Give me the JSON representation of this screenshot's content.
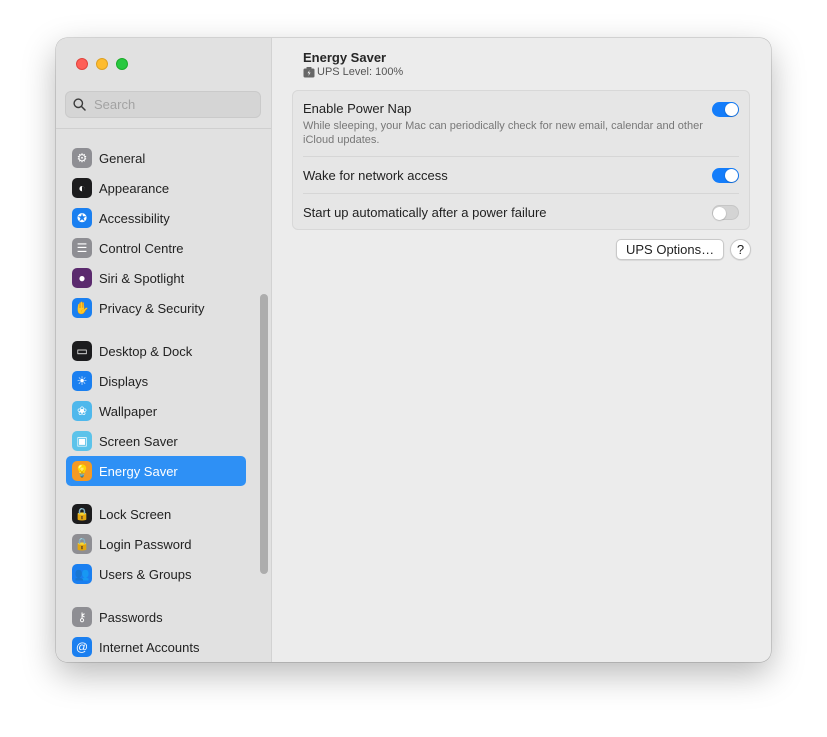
{
  "window": {
    "traffic_lights": [
      "close",
      "minimize",
      "maximize"
    ]
  },
  "sidebar": {
    "search_placeholder": "Search",
    "search_value": "",
    "groups": [
      [
        {
          "label": "General",
          "icon": "gear-icon",
          "color": "#8e8e93"
        },
        {
          "label": "Appearance",
          "icon": "appearance-icon",
          "color": "#1c1c1e"
        },
        {
          "label": "Accessibility",
          "icon": "accessibility-icon",
          "color": "#1a7ff0"
        },
        {
          "label": "Control Centre",
          "icon": "control-centre-icon",
          "color": "#8e8e93"
        },
        {
          "label": "Siri & Spotlight",
          "icon": "siri-icon",
          "color": "#5b2a6e"
        },
        {
          "label": "Privacy & Security",
          "icon": "hand-icon",
          "color": "#1a7ff0"
        }
      ],
      [
        {
          "label": "Desktop & Dock",
          "icon": "dock-icon",
          "color": "#1c1c1e"
        },
        {
          "label": "Displays",
          "icon": "sun-icon",
          "color": "#1a7ff0"
        },
        {
          "label": "Wallpaper",
          "icon": "flower-icon",
          "color": "#4fb8ec"
        },
        {
          "label": "Screen Saver",
          "icon": "screen-saver-icon",
          "color": "#5cc3ea"
        },
        {
          "label": "Energy Saver",
          "icon": "lightbulb-icon",
          "color": "#f59a23",
          "active": true
        }
      ],
      [
        {
          "label": "Lock Screen",
          "icon": "lock-screen-icon",
          "color": "#1c1c1e"
        },
        {
          "label": "Login Password",
          "icon": "lock-icon",
          "color": "#8e8e93"
        },
        {
          "label": "Users & Groups",
          "icon": "users-icon",
          "color": "#1a7ff0"
        }
      ],
      [
        {
          "label": "Passwords",
          "icon": "key-icon",
          "color": "#8e8e93"
        },
        {
          "label": "Internet Accounts",
          "icon": "at-icon",
          "color": "#1a7ff0"
        }
      ]
    ]
  },
  "content": {
    "title": "Energy Saver",
    "ups_level": "UPS Level: 100%",
    "settings": [
      {
        "label": "Enable Power Nap",
        "description": "While sleeping, your Mac can periodically check for new email, calendar and other iCloud updates.",
        "enabled": true
      },
      {
        "label": "Wake for network access",
        "description": "",
        "enabled": true
      },
      {
        "label": "Start up automatically after a power failure",
        "description": "",
        "enabled": false
      }
    ],
    "ups_options_label": "UPS Options…",
    "help_label": "?"
  },
  "colors": {
    "accent": "#147dfa",
    "sidebar_selected": "#2e90f5"
  }
}
